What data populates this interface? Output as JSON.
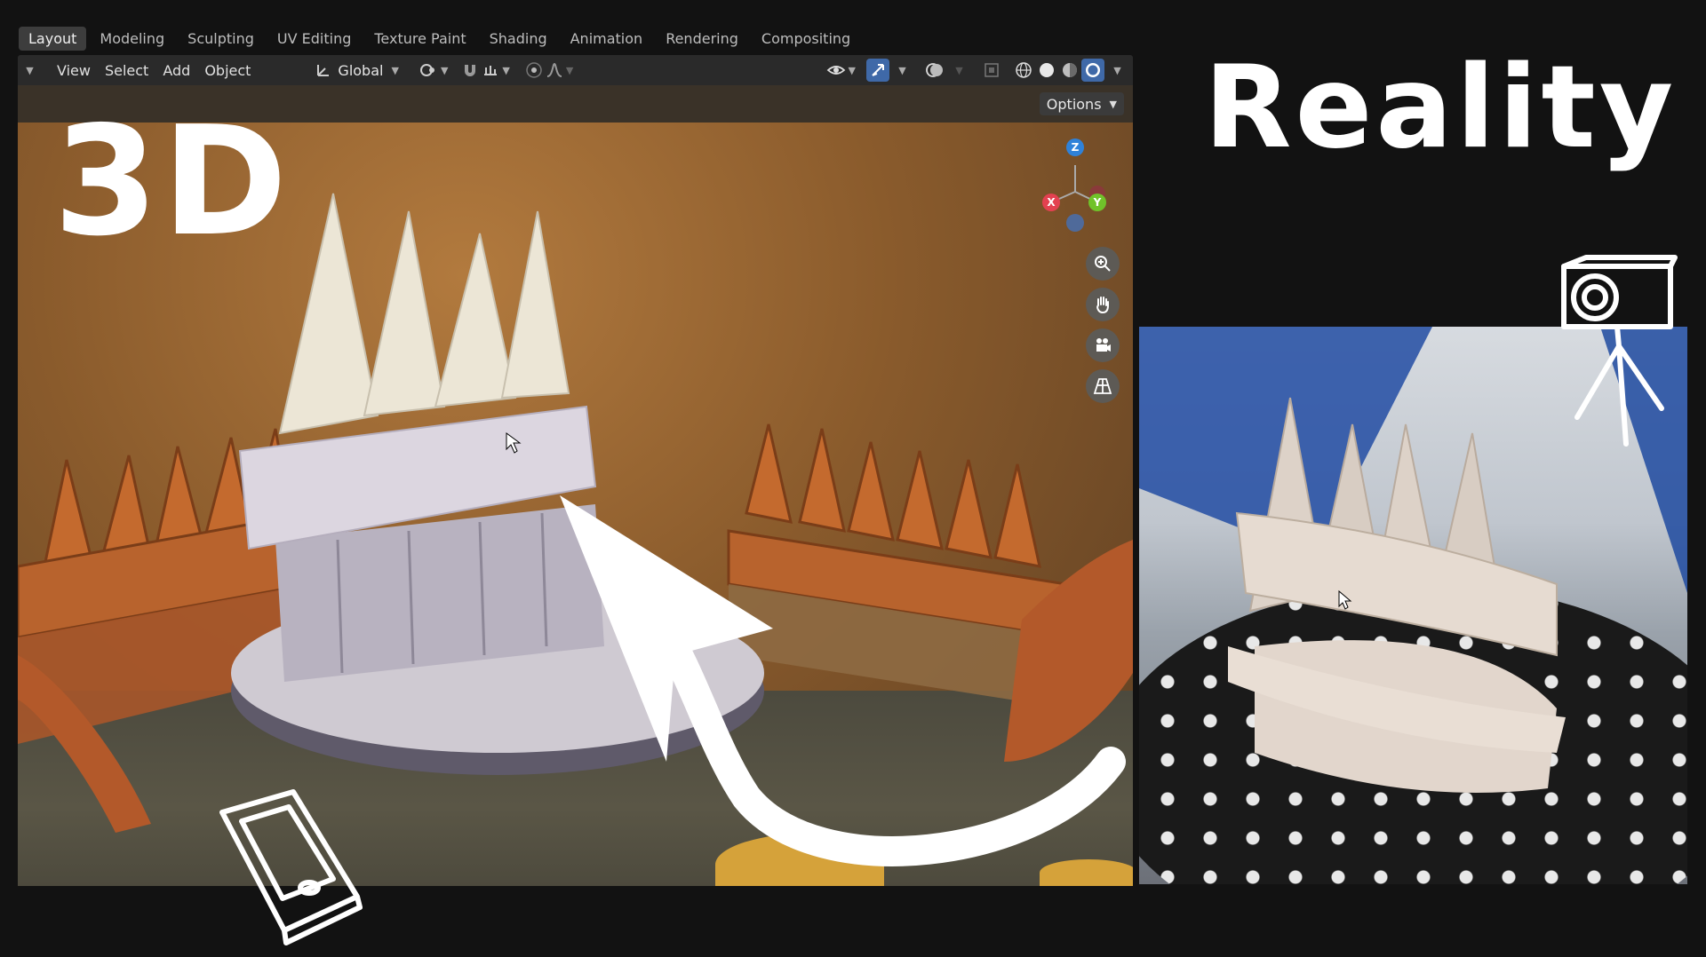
{
  "workspace_tabs": [
    {
      "label": "Layout",
      "active": true
    },
    {
      "label": "Modeling",
      "active": false
    },
    {
      "label": "Sculpting",
      "active": false
    },
    {
      "label": "UV Editing",
      "active": false
    },
    {
      "label": "Texture Paint",
      "active": false
    },
    {
      "label": "Shading",
      "active": false
    },
    {
      "label": "Animation",
      "active": false
    },
    {
      "label": "Rendering",
      "active": false
    },
    {
      "label": "Compositing",
      "active": false
    }
  ],
  "header": {
    "menus": [
      "View",
      "Select",
      "Add",
      "Object"
    ],
    "transform_orientation": "Global",
    "options_label": "Options"
  },
  "gizmo": {
    "z": "Z",
    "x": "X",
    "y": "Y"
  },
  "overlay_text": {
    "left_title": "3D",
    "right_title": "Reality"
  },
  "colors": {
    "blender_bg": "#2a2a2a",
    "accent_blue": "#3f69a8",
    "axis_x": "#e34150",
    "axis_y": "#70c22a",
    "axis_z": "#2f82d9"
  }
}
